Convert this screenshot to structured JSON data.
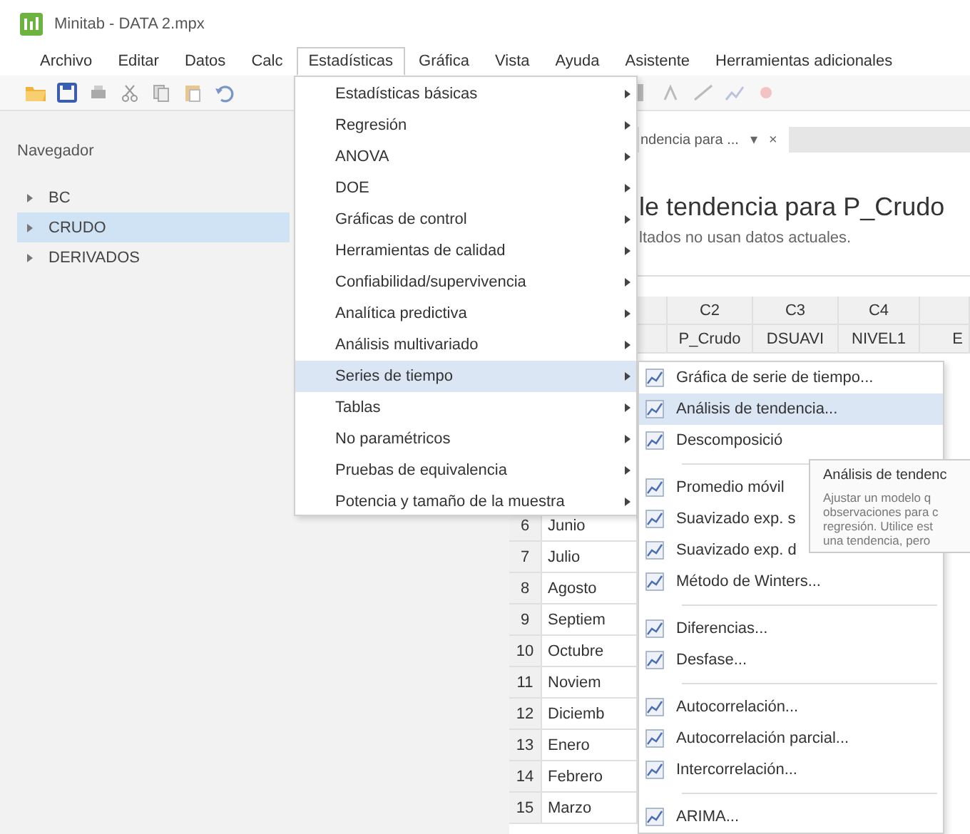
{
  "window": {
    "title": "Minitab - DATA 2.mpx"
  },
  "menu_bar": [
    {
      "label": "Archivo",
      "selected": false
    },
    {
      "label": "Editar",
      "selected": false
    },
    {
      "label": "Datos",
      "selected": false
    },
    {
      "label": "Calc",
      "selected": false
    },
    {
      "label": "Estadísticas",
      "selected": true
    },
    {
      "label": "Gráfica",
      "selected": false
    },
    {
      "label": "Vista",
      "selected": false
    },
    {
      "label": "Ayuda",
      "selected": false
    },
    {
      "label": "Asistente",
      "selected": false
    },
    {
      "label": "Herramientas adicionales",
      "selected": false
    }
  ],
  "navigator": {
    "title": "Navegador",
    "items": [
      {
        "label": "BC",
        "selected": false
      },
      {
        "label": "CRUDO",
        "selected": true
      },
      {
        "label": "DERIVADOS",
        "selected": false
      }
    ]
  },
  "output_tab": {
    "label": "ndencia para ...",
    "pin": "▾",
    "close": "×"
  },
  "output": {
    "heading": "le tendencia para P_Crudo",
    "note": "ltados no usan datos actuales."
  },
  "worksheet": {
    "column_ids": [
      "C2",
      "C3",
      "C4"
    ],
    "column_names": [
      "P_Crudo",
      "DSUAVI",
      "NIVEL1",
      "E"
    ],
    "rows": [
      {
        "row": "6",
        "month": "Junio"
      },
      {
        "row": "7",
        "month": "Julio"
      },
      {
        "row": "8",
        "month": "Agosto"
      },
      {
        "row": "9",
        "month": "Septiem"
      },
      {
        "row": "10",
        "month": "Octubre"
      },
      {
        "row": "11",
        "month": "Noviem"
      },
      {
        "row": "12",
        "month": "Diciemb"
      },
      {
        "row": "13",
        "month": "Enero"
      },
      {
        "row": "14",
        "month": "Febrero"
      },
      {
        "row": "15",
        "month": "Marzo"
      }
    ]
  },
  "menu": {
    "items": [
      {
        "label": "Estadísticas básicas",
        "selected": false
      },
      {
        "label": "Regresión",
        "selected": false
      },
      {
        "label": "ANOVA",
        "selected": false
      },
      {
        "label": "DOE",
        "selected": false
      },
      {
        "label": "Gráficas de control",
        "selected": false
      },
      {
        "label": "Herramientas de calidad",
        "selected": false
      },
      {
        "label": "Confiabilidad/supervivencia",
        "selected": false
      },
      {
        "label": "Analítica predictiva",
        "selected": false
      },
      {
        "label": "Análisis multivariado",
        "selected": false
      },
      {
        "label": "Series de tiempo",
        "selected": true
      },
      {
        "label": "Tablas",
        "selected": false
      },
      {
        "label": "No paramétricos",
        "selected": false
      },
      {
        "label": "Pruebas de equivalencia",
        "selected": false
      },
      {
        "label": "Potencia y tamaño de la muestra",
        "selected": false
      }
    ]
  },
  "submenu": {
    "groups": [
      [
        {
          "label": "Gráfica de serie de tiempo...",
          "selected": false
        },
        {
          "label": "Análisis de tendencia...",
          "selected": true
        },
        {
          "label": "Descomposició",
          "selected": false
        }
      ],
      [
        {
          "label": "Promedio móvil",
          "selected": false
        },
        {
          "label": "Suavizado exp. s",
          "selected": false
        },
        {
          "label": "Suavizado exp. d",
          "selected": false
        },
        {
          "label": "Método de Winters...",
          "selected": false
        }
      ],
      [
        {
          "label": "Diferencias...",
          "selected": false
        },
        {
          "label": "Desfase...",
          "selected": false
        }
      ],
      [
        {
          "label": "Autocorrelación...",
          "selected": false
        },
        {
          "label": "Autocorrelación parcial...",
          "selected": false
        },
        {
          "label": "Intercorrelación...",
          "selected": false
        }
      ],
      [
        {
          "label": "ARIMA...",
          "selected": false
        }
      ]
    ]
  },
  "tooltip": {
    "title": "Análisis de tendenc",
    "lines": [
      "Ajustar un modelo q",
      "observaciones para c",
      "regresión. Utilice est",
      "una tendencia, pero"
    ]
  }
}
